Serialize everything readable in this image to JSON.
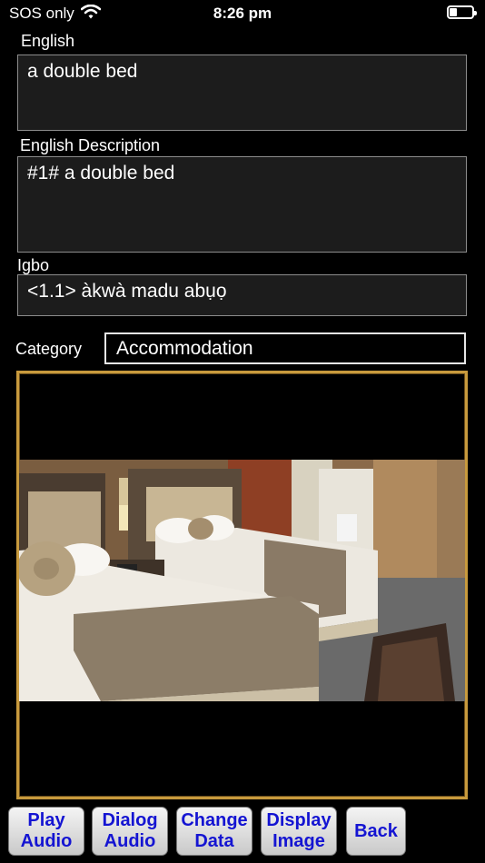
{
  "status_bar": {
    "carrier": "SOS only",
    "time": "8:26 pm"
  },
  "fields": {
    "english": {
      "label": "English",
      "value": "a double bed"
    },
    "english_description": {
      "label": "English Description",
      "value": "#1# a double bed"
    },
    "igbo": {
      "label": "Igbo",
      "value": "<1.1> àkwà madu abụọ"
    },
    "category": {
      "label": "Category",
      "value": "Accommodation"
    }
  },
  "buttons": [
    {
      "label": "Play\nAudio"
    },
    {
      "label": "Dialog\nAudio"
    },
    {
      "label": "Change\nData"
    },
    {
      "label": "Display\nImage"
    },
    {
      "label": "Back"
    }
  ],
  "colors": {
    "button_text": "#1414d2",
    "frame_gold": "#c89a3d"
  }
}
